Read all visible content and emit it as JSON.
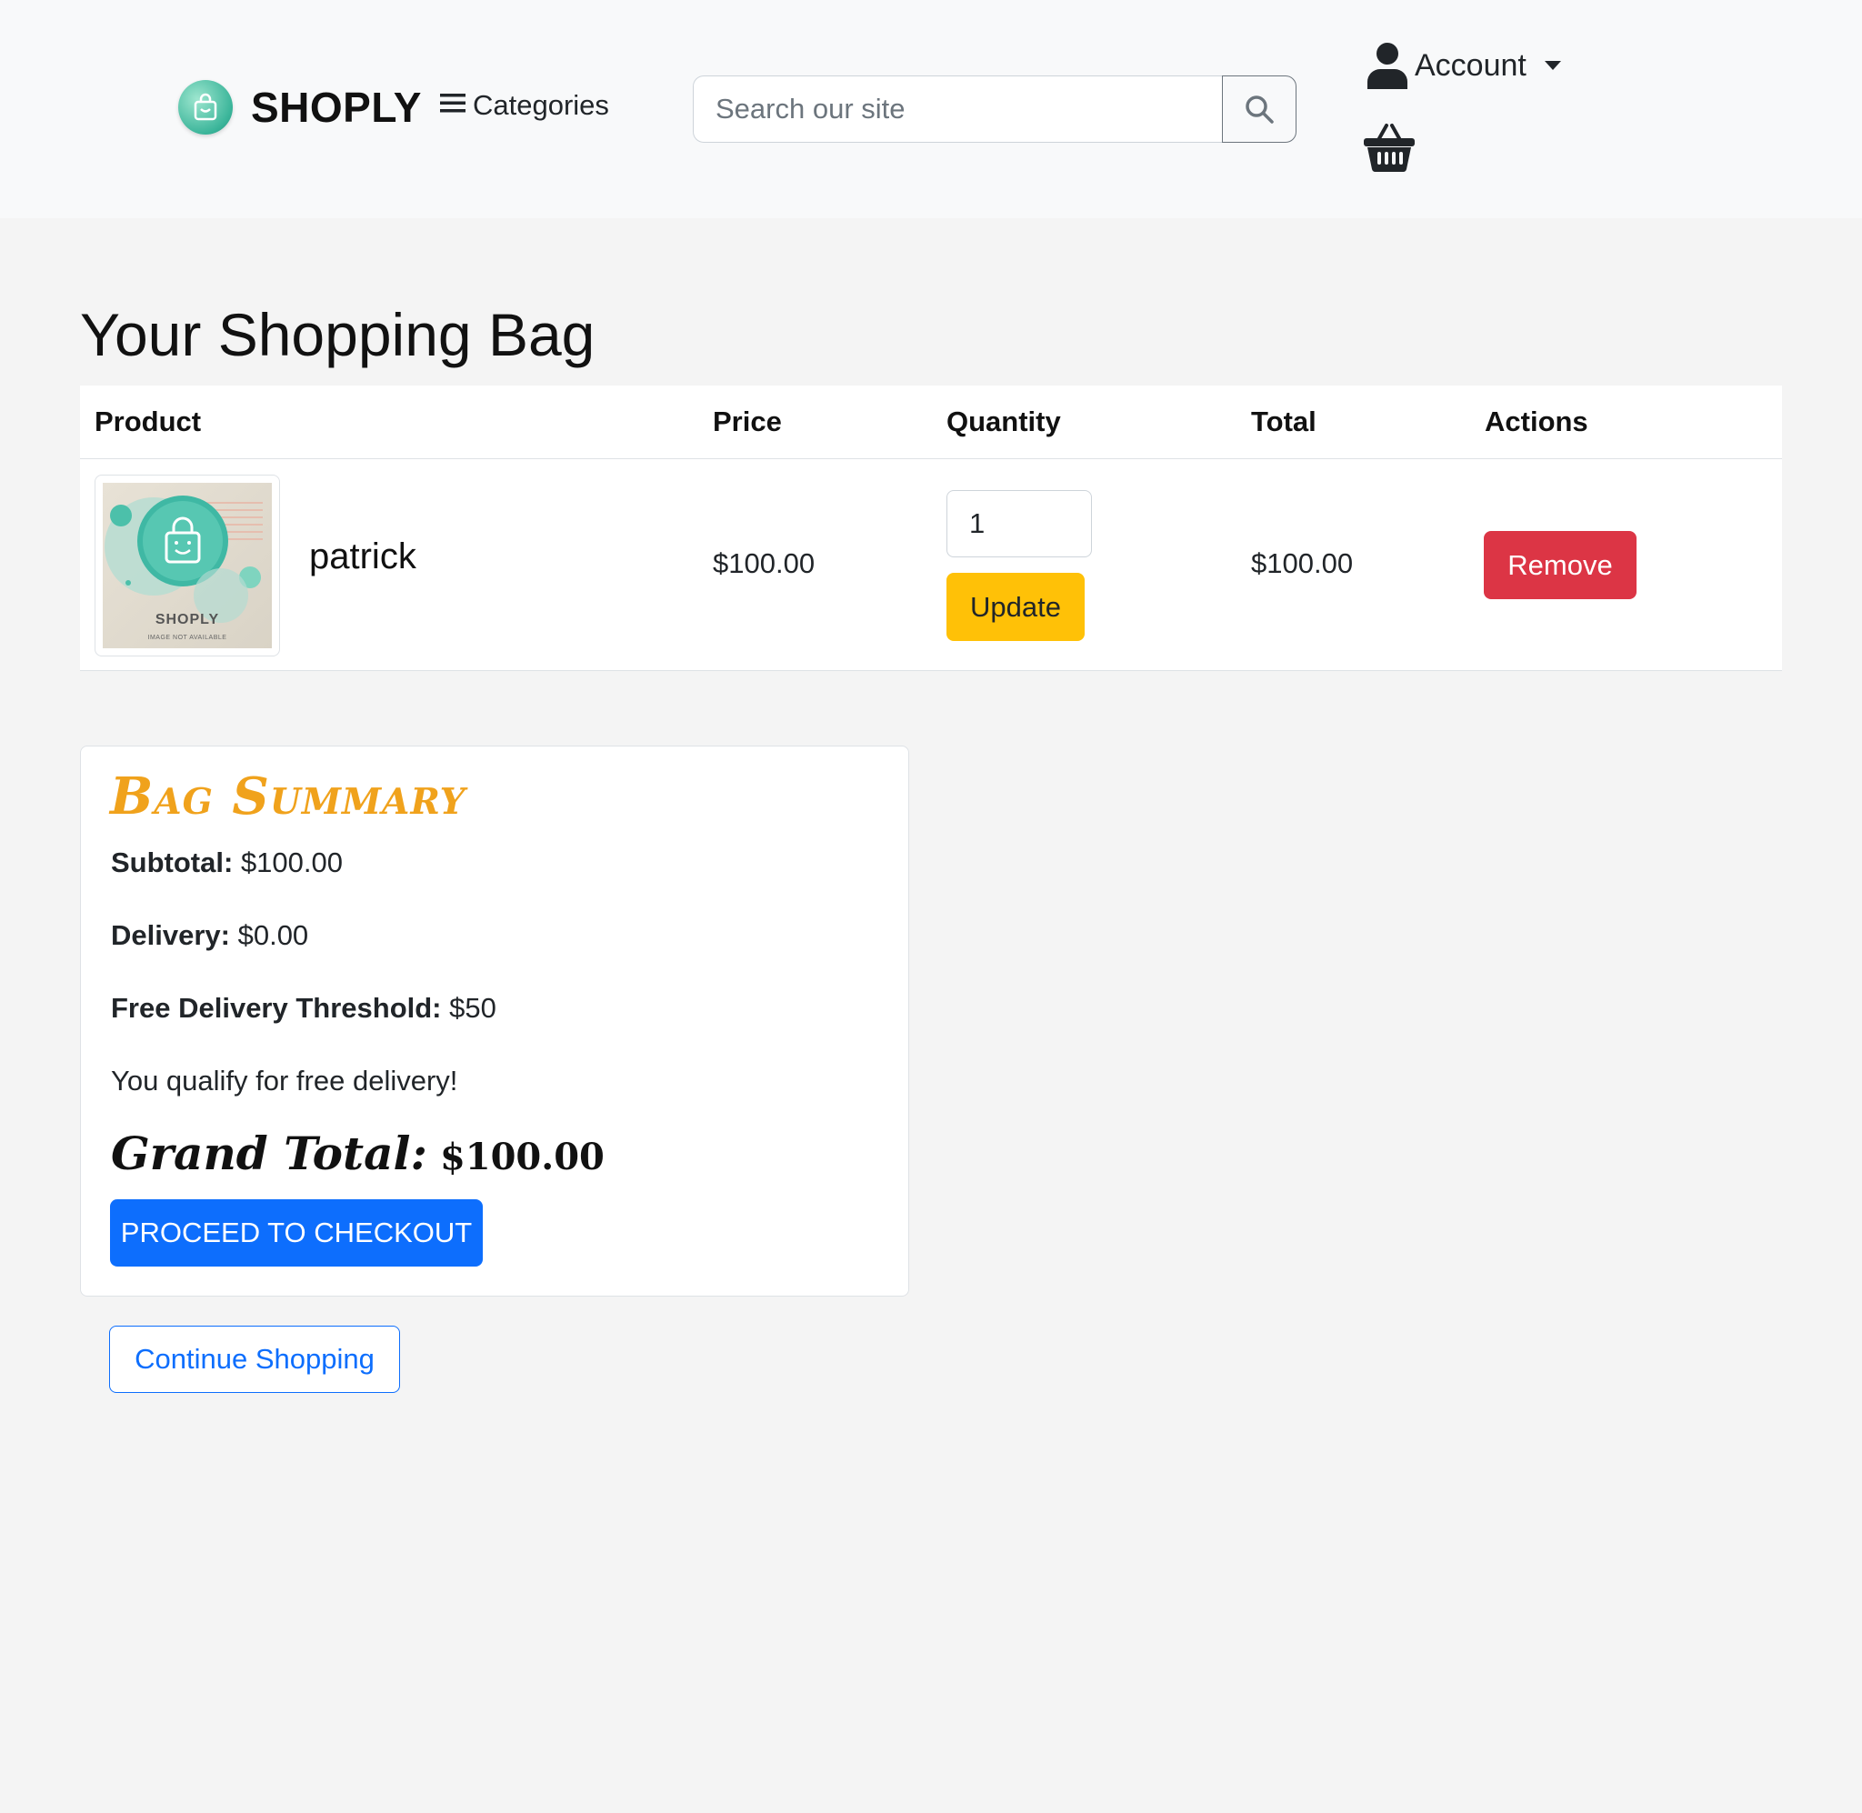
{
  "header": {
    "brand_name": "SHOPLY",
    "categories_label": "Categories",
    "search_placeholder": "Search our site",
    "account_label": "Account"
  },
  "page": {
    "title": "Your Shopping Bag"
  },
  "table": {
    "headers": [
      "Product",
      "Price",
      "Quantity",
      "Total",
      "Actions"
    ],
    "rows": [
      {
        "image_caption": "SHOPLY",
        "image_subcaption": "IMAGE NOT AVAILABLE",
        "name": "patrick",
        "price": "$100.00",
        "quantity": "1",
        "total": "$100.00",
        "update_label": "Update",
        "remove_label": "Remove"
      }
    ]
  },
  "summary": {
    "title": "Bag Summary",
    "subtotal_label": "Subtotal:",
    "subtotal_value": "$100.00",
    "delivery_label": "Delivery:",
    "delivery_value": "$0.00",
    "threshold_label": "Free Delivery Threshold:",
    "threshold_value": "$50",
    "free_delivery_message": "You qualify for free delivery!",
    "grand_total_label": "Grand Total:",
    "grand_total_value": "$100.00",
    "checkout_label": "PROCEED TO CHECKOUT"
  },
  "continue_label": "Continue Shopping",
  "colors": {
    "primary": "#0d6efd",
    "warning": "#ffc107",
    "danger": "#dc3545",
    "summary_title": "#f0a21c"
  },
  "icons": [
    "shopping-bag-logo-icon",
    "hamburger-menu-icon",
    "search-icon",
    "user-icon",
    "caret-down-icon",
    "basket-icon"
  ]
}
